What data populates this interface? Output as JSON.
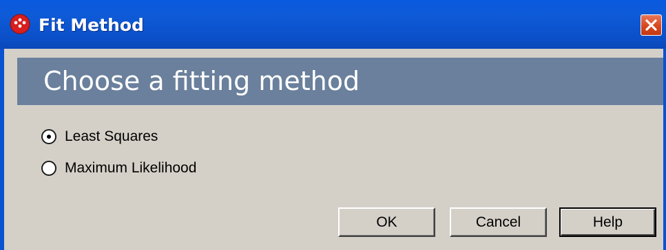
{
  "window": {
    "title": "Fit Method",
    "title_icon": "app-dots-icon",
    "close_icon": "close-x-icon"
  },
  "header": {
    "text": "Choose a fitting method"
  },
  "options": [
    {
      "label": "Least Squares",
      "selected": true
    },
    {
      "label": "Maximum Likelihood",
      "selected": false
    }
  ],
  "buttons": {
    "ok_label": "OK",
    "cancel_label": "Cancel",
    "help_label": "Help"
  },
  "colors": {
    "titlebar": "#0b52d0",
    "header_band": "#6a809c",
    "dialog_bg": "#d4d0c8",
    "close_button": "#d9471e",
    "icon_red": "#d81e1e"
  }
}
